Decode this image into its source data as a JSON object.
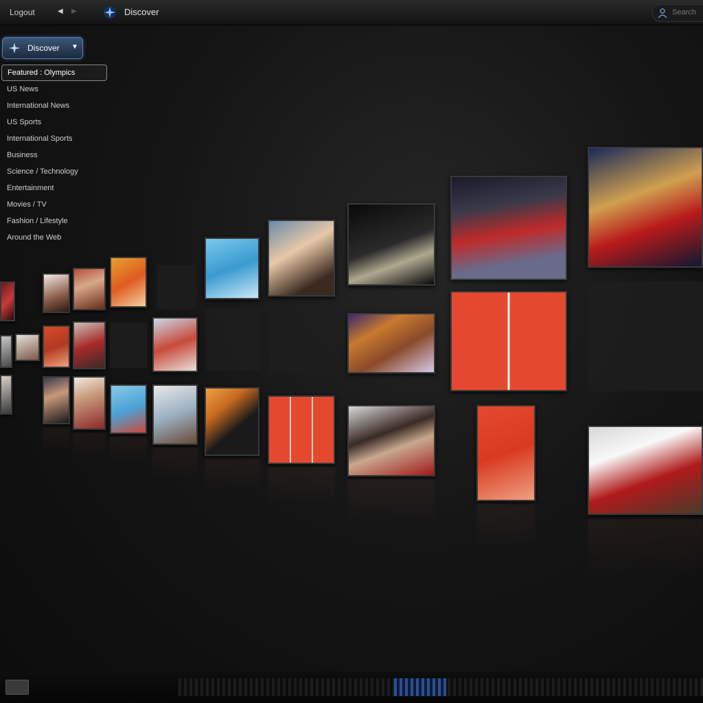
{
  "topbar": {
    "logout_label": "Logout",
    "back_glyph": "◀",
    "forward_glyph": "▶",
    "brand_icon": "discover-star-icon",
    "app_title": "Discover",
    "search_placeholder": "Search",
    "search_icon": "person-search-icon"
  },
  "discover_button": {
    "label": "Discover",
    "caret": "▼",
    "icon": "discover-star-icon"
  },
  "menu": {
    "items": [
      {
        "label": "Featured : Olympics",
        "active": true
      },
      {
        "label": "US News"
      },
      {
        "label": "International News"
      },
      {
        "label": "US Sports"
      },
      {
        "label": "International Sports"
      },
      {
        "label": "Business"
      },
      {
        "label": "Science / Technology"
      },
      {
        "label": "Entertainment"
      },
      {
        "label": "Movies / TV"
      },
      {
        "label": "Fashion / Lifestyle"
      },
      {
        "label": "Around the Web"
      }
    ]
  },
  "colors": {
    "accent_blue": "#5a7fb3",
    "track_red": "#e4492f",
    "pool_blue": "#4aa3d8"
  },
  "tiles": [
    {
      "name": "tile-athlete-red-edge",
      "subject": "athlete in red"
    },
    {
      "name": "tile-woman-portrait",
      "subject": "woman portrait"
    },
    {
      "name": "tile-team-photo",
      "subject": "team group"
    },
    {
      "name": "tile-gymnast-orange",
      "subject": "gymnast orange"
    },
    {
      "name": "tile-synchro-swimmers",
      "subject": "synchronized swimmers"
    },
    {
      "name": "tile-blonde-gymnast",
      "subject": "blonde gymnast"
    },
    {
      "name": "tile-beam-pose",
      "subject": "balance beam pose"
    },
    {
      "name": "tile-beam-gymnast-red",
      "subject": "beam gymnast red"
    },
    {
      "name": "tile-gold-gymnast-closeup",
      "subject": "gymnast closeup"
    },
    {
      "name": "tile-small-portrait-1",
      "subject": "small portrait"
    },
    {
      "name": "tile-red-runners-small",
      "subject": "runners"
    },
    {
      "name": "tile-athlete-red-small",
      "subject": "athlete"
    },
    {
      "name": "tile-runner-on-track",
      "subject": "runner track"
    },
    {
      "name": "tile-medal-celebration",
      "subject": "medal"
    },
    {
      "name": "tile-two-sprinters-red",
      "subject": "two sprinters"
    },
    {
      "name": "tile-small-edge-1",
      "subject": "edge"
    },
    {
      "name": "tile-small-edge-2",
      "subject": "edge"
    },
    {
      "name": "tile-woman-headshot",
      "subject": "woman headshot"
    },
    {
      "name": "tile-cheering-woman",
      "subject": "cheering"
    },
    {
      "name": "tile-swimmers-blue",
      "subject": "swimmers"
    },
    {
      "name": "tile-race-pack",
      "subject": "race"
    },
    {
      "name": "tile-woman-singer",
      "subject": "woman"
    },
    {
      "name": "tile-three-runners-red",
      "subject": "three runners"
    },
    {
      "name": "tile-man-cap-portrait",
      "subject": "man in cap"
    },
    {
      "name": "tile-sprinter-red",
      "subject": "sprinter"
    },
    {
      "name": "tile-panama-flag",
      "subject": "flag"
    }
  ]
}
